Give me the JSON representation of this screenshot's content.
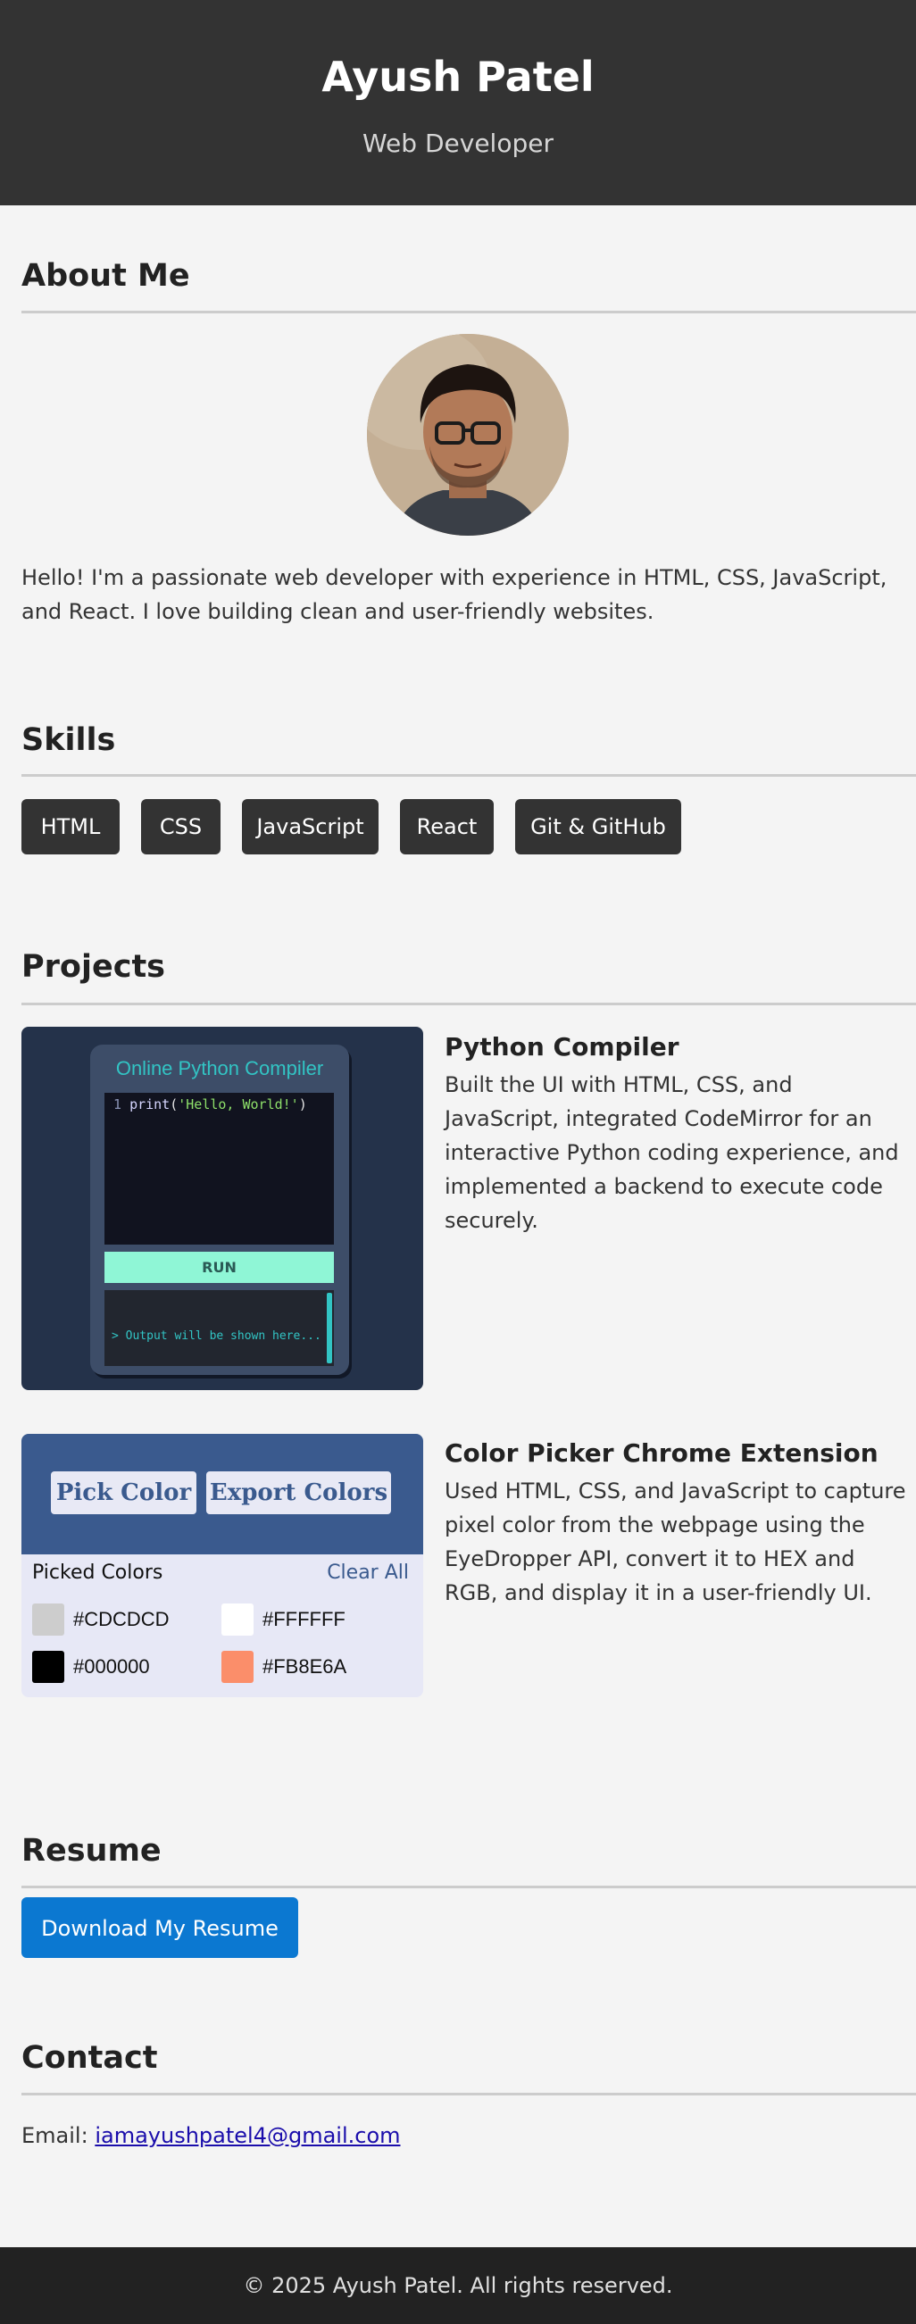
{
  "header": {
    "name": "Ayush Patel",
    "role": "Web Developer"
  },
  "about": {
    "heading": "About Me",
    "text": "Hello! I'm a passionate web developer with experience in HTML, CSS, JavaScript, and React. I love building clean and user-friendly websites."
  },
  "skills": {
    "heading": "Skills",
    "items": [
      "HTML",
      "CSS",
      "JavaScript",
      "React",
      "Git & GitHub"
    ]
  },
  "projects": {
    "heading": "Projects",
    "items": [
      {
        "title": "Python Compiler",
        "description": "Built the UI with HTML, CSS, and JavaScript, integrated CodeMirror for an interactive Python coding experience, and implemented a backend to execute code securely.",
        "preview": {
          "app_title": "Online Python Compiler",
          "line_number": "1",
          "code_fn": "print",
          "code_str": "'Hello, World!'",
          "run_label": "RUN",
          "output_placeholder": "> Output will be shown here..."
        }
      },
      {
        "title": "Color Picker Chrome Extension",
        "description": "Used HTML, CSS, and JavaScript to capture pixel color from the webpage using the EyeDropper API, convert it to HEX and RGB, and display it in a user-friendly UI.",
        "preview": {
          "pick_label": "Pick Color",
          "export_label": "Export Colors",
          "picked_label": "Picked Colors",
          "clear_label": "Clear All",
          "colors": [
            "#CDCDCD",
            "#FFFFFF",
            "#000000",
            "#FB8E6A"
          ]
        }
      }
    ]
  },
  "resume": {
    "heading": "Resume",
    "button_label": "Download My Resume"
  },
  "contact": {
    "heading": "Contact",
    "email_label": "Email:",
    "email": "iamayushpatel4@gmail.com"
  },
  "footer": {
    "text": "© 2025 Ayush Patel. All rights reserved."
  },
  "colors": {
    "header_bg": "#333333",
    "footer_bg": "#222222",
    "accent": "#0b78d1",
    "page_bg": "#f4f4f4"
  }
}
